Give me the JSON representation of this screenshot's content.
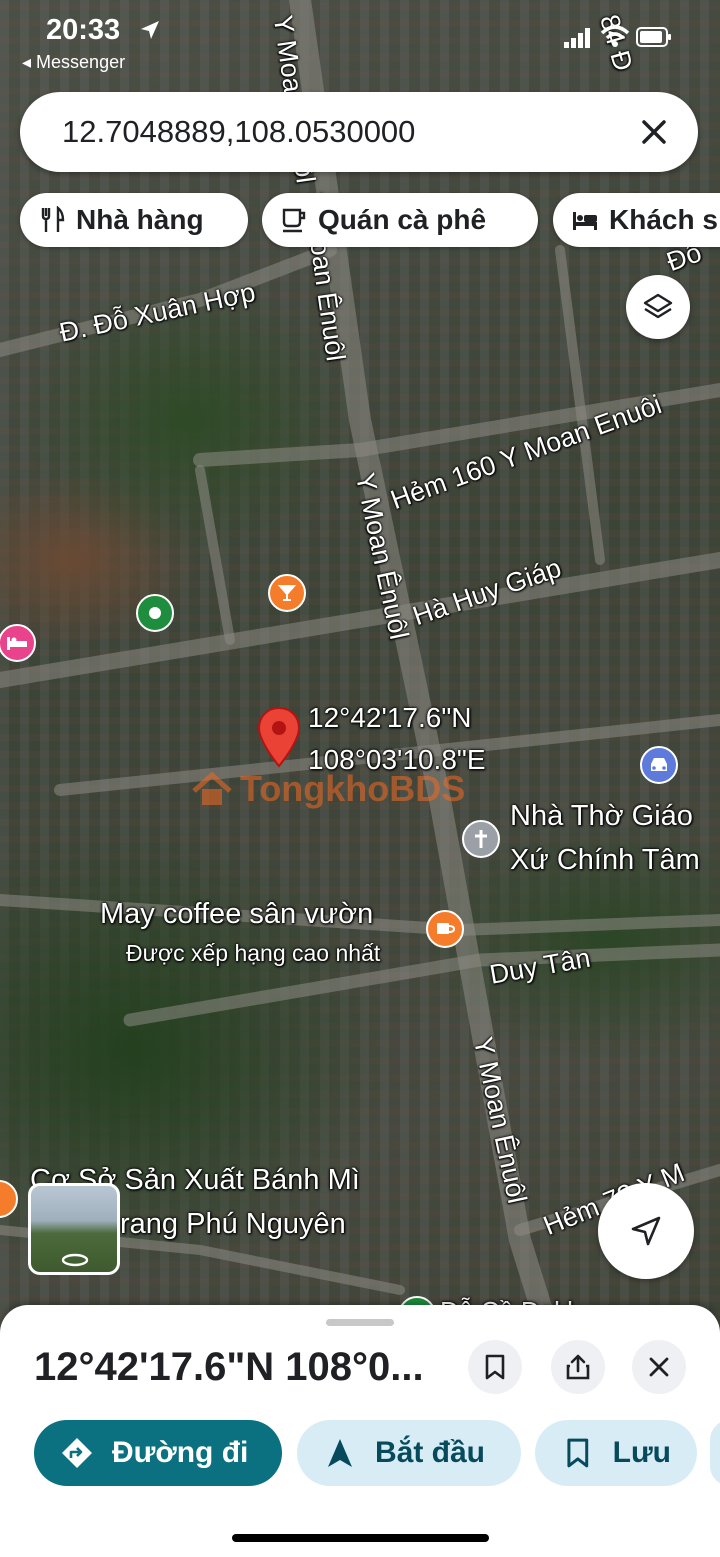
{
  "status_bar": {
    "time": "20:33",
    "back_app": "◂ Messenger"
  },
  "search": {
    "query": "12.7048889,108.0530000",
    "close_icon": "close-icon"
  },
  "chips": [
    {
      "label": "Nhà hàng",
      "icon": "restaurant-icon"
    },
    {
      "label": "Quán cà phê",
      "icon": "coffee-icon"
    },
    {
      "label": "Khách s",
      "icon": "hotel-icon"
    }
  ],
  "map": {
    "street_labels": [
      "Y Moan Ênuôl",
      "Y Moan Ênuôl",
      "Y Moan Ênuôl",
      "Y Moan Ênuôl",
      "Đ. Đỗ Xuân Hợp",
      "Hẻm 160 Y Moan Enuôi",
      "Hà Huy Giáp",
      "Duy Tân",
      "Hẻm 72 Y M",
      "84 Đ",
      "Đô",
      "Đỗ"
    ],
    "pin_coords": {
      "lat": "12°42'17.6\"N",
      "lng": "108°03'10.8\"E"
    },
    "watermark": "TongkhoBDS",
    "pois": {
      "church_name_1": "Nhà Thờ Giáo",
      "church_name_2": "Xứ Chính Tâm",
      "cafe_name": "May coffee sân vườn",
      "cafe_sub": "Được xếp hạng cao nhất",
      "bakery_name_1": "Cơ Sở Sản Xuất Bánh Mì",
      "bakery_name_2": "rang Phú Nguyên",
      "partial_bottom": "Đỗ Cồ Dakl"
    },
    "colors": {
      "pin": "#ea4335",
      "orange_poi": "#f57c2b",
      "green_poi": "#1e8e3e",
      "pink_poi": "#e8438b",
      "blue_poi": "#5e7bdc",
      "grey_poi": "#9aa0a6"
    }
  },
  "sheet": {
    "title": "12°42'17.6\"N 108°0...",
    "actions": [
      {
        "label": "Đường đi",
        "icon": "directions-icon"
      },
      {
        "label": "Bắt đầu",
        "icon": "navigation-arrow-icon"
      },
      {
        "label": "Lưu",
        "icon": "bookmark-icon"
      }
    ],
    "colors": {
      "primary": "#0b7180",
      "secondary_bg": "#d7ecf5",
      "secondary_fg": "#074a5c"
    }
  }
}
